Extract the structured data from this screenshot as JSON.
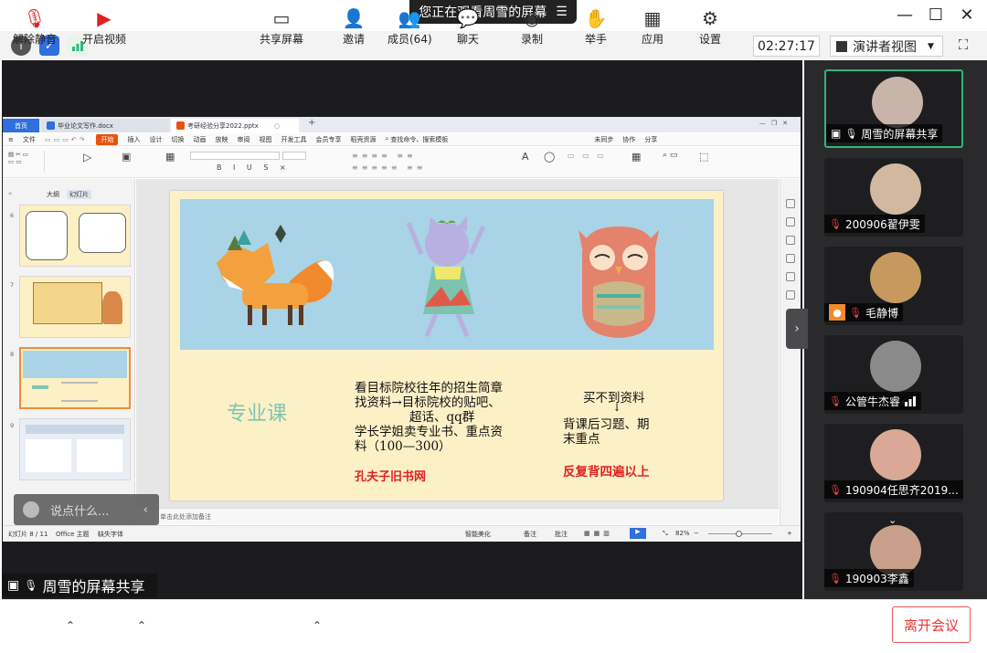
{
  "meeting": {
    "viewing_banner": "您正在观看周雪的屏幕",
    "timer": "02:27:17",
    "view_mode": "演讲者视图",
    "presenter_tag": "周雪的屏幕共享"
  },
  "participants": [
    {
      "name": "周雪的屏幕共享",
      "mic": "on",
      "active": true
    },
    {
      "name": "200906翟伊雯",
      "mic": "muted"
    },
    {
      "name": "毛静博",
      "mic": "muted"
    },
    {
      "name": "公管牛杰睿",
      "mic": "muted"
    },
    {
      "name": "190904任思齐2019...",
      "mic": "muted"
    },
    {
      "name": "190903李鑫",
      "mic": "muted"
    }
  ],
  "toolbar": {
    "unmute": "解除静音",
    "start_video": "开启视频",
    "share_screen": "共享屏幕",
    "invite": "邀请",
    "members": "成员(64)",
    "chat": "聊天",
    "record": "录制",
    "raise_hand": "举手",
    "apps": "应用",
    "settings": "设置",
    "leave": "离开会议"
  },
  "chat_popup": {
    "placeholder": "说点什么..."
  },
  "wps": {
    "tab_home": "首页",
    "tab_doc": "毕业论文写作.docx",
    "tab_ppt": "考研经验分享2022.pptx",
    "menu": [
      "文件",
      "开始",
      "插入",
      "设计",
      "切换",
      "动画",
      "放映",
      "审阅",
      "视图",
      "开发工具",
      "会员专享",
      "稻壳资源"
    ],
    "menu_search": "查找命令、搜索模板",
    "menu_right": [
      "未同步",
      "协作",
      "分享"
    ],
    "thumb_tabs": [
      "大纲",
      "幻灯片"
    ],
    "slide_numbers": [
      "6",
      "7",
      "8",
      "9"
    ],
    "notes_placeholder": "单击此处添加备注",
    "status_slide": "幻灯片 8 / 11",
    "status_theme": "Office 主题",
    "status_font": "缺失字体",
    "status_beautify": "智能美化",
    "status_notes": "备注",
    "status_comment": "批注",
    "zoom": "82%"
  },
  "slide": {
    "title": "专业课",
    "left_lines": [
      "看目标院校往年的招生简章",
      "找资料→目标院校的贴吧、",
      "超话、qq群",
      "学长学姐卖专业书、重点资",
      "料（100—300）"
    ],
    "left_red": "孔夫子旧书网",
    "right_top": "买不到资料",
    "right_arrow": "↓",
    "right_lines": [
      "背课后习题、期",
      "末重点"
    ],
    "right_red": "反复背四遍以上"
  },
  "colors": {
    "accent_green": "#2fb67c",
    "leave_red": "#e33333",
    "slide_bg": "#fcf0c6",
    "banner_blue": "#a9d3e6",
    "slide_title": "#7ec5b4",
    "slide_red": "#e22020",
    "wps_start": "#e8520c"
  }
}
